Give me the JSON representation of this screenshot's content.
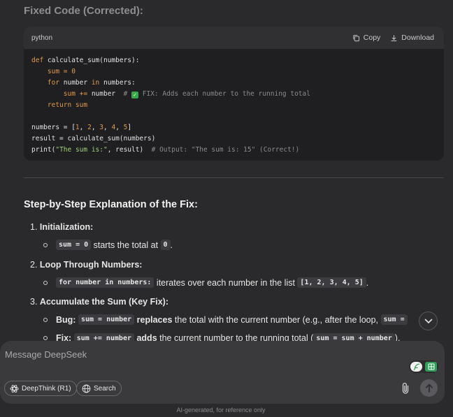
{
  "section_title": "Fixed Code (Corrected):",
  "code_block": {
    "language": "python",
    "copy_label": "Copy",
    "download_label": "Download",
    "lines": {
      "l1_kw": "def",
      "l1_fn": " calculate_sum",
      "l1_rest": "(numbers):",
      "l2_var": "    sum",
      "l2_op": " = ",
      "l2_num": "0",
      "l3_kw": "    for",
      "l3_a": " number ",
      "l3_kw2": "in",
      "l3_b": " numbers:",
      "l4_var": "        sum",
      "l4_op": " += ",
      "l4_b": "number  ",
      "l4_cm1": "# ",
      "l4_check": "✓",
      "l4_cm2": " FIX: Adds each number to the running total",
      "l5_kw": "    return",
      "l5_var": " sum",
      "l7_a": "numbers = [",
      "l7_n1": "1",
      "l7_c1": ", ",
      "l7_n2": "2",
      "l7_c2": ", ",
      "l7_n3": "3",
      "l7_c3": ", ",
      "l7_n4": "4",
      "l7_c4": ", ",
      "l7_n5": "5",
      "l7_b": "]",
      "l8": "result = calculate_sum(numbers)",
      "l9_fn": "print",
      "l9_a": "(",
      "l9_str": "\"The sum is:\"",
      "l9_b": ", result)  ",
      "l9_cm": "# Output: \"The sum is: 15\" (Correct!)"
    }
  },
  "explanation": {
    "heading": "Step-by-Step Explanation of the Fix:",
    "items": [
      {
        "number": "1.",
        "title": "Initialization:",
        "bullet": {
          "code": "sum = 0",
          "text": " starts the total at ",
          "code2": "0",
          "tail": "."
        }
      },
      {
        "number": "2.",
        "title": "Loop Through Numbers:",
        "bullet": {
          "code": "for number in numbers:",
          "text": " iterates over each number in the list ",
          "code2": "[1, 2, 3, 4, 5]",
          "tail": "."
        }
      },
      {
        "number": "3.",
        "title": "Accumulate the Sum (Key Fix):",
        "bullet1": {
          "label": "Bug:",
          "code": "sum = number",
          "bold_text": " replaces",
          "text": " the total with the current number (e.g., after the loop, ",
          "code2": "sum = "
        },
        "bullet2": {
          "label": "Fix:",
          "code": "sum += number",
          "bold_text": " adds",
          "text": " the current number to the running total (",
          "code2": "sum = sum + number",
          "tail": ")."
        }
      }
    ]
  },
  "composer": {
    "placeholder": "Message DeepSeek",
    "deepthink_label": "DeepThink (R1)",
    "search_label": "Search"
  },
  "footer": "AI-generated, for reference only",
  "colors": {
    "accent_green": "#2f9e58",
    "keyword": "#e29a4a",
    "string": "#9bd17a"
  }
}
